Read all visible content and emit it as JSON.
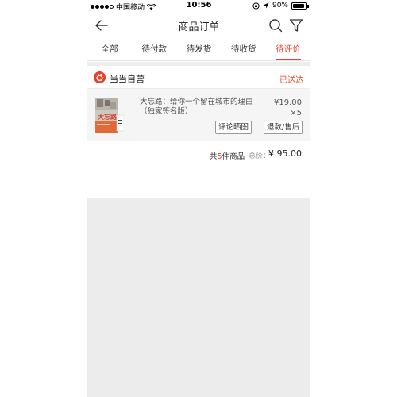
{
  "status_bar": {
    "carrier": "中国移动",
    "time": "10:56",
    "battery": "90%",
    "battery_level": 0.9
  },
  "nav": {
    "title": "商品订单",
    "back_icon": "back-arrow-icon",
    "search_icon": "search-icon",
    "filter_icon": "filter-icon"
  },
  "tabs": [
    {
      "label": "全部",
      "active": false
    },
    {
      "label": "待付款",
      "active": false
    },
    {
      "label": "待发货",
      "active": false
    },
    {
      "label": "待收货",
      "active": false
    },
    {
      "label": "待评价",
      "active": true
    }
  ],
  "order": {
    "shop_name": "当当自营",
    "status": "已送达",
    "product": {
      "title_line1": "大忘路：给你一个留在城市的理由",
      "title_line2": "（独家签名版）",
      "price": "¥19.00",
      "quantity": "×5",
      "cover_text": "大忘路"
    },
    "buttons": {
      "review": "评论晒图",
      "refund": "退款/售后"
    },
    "summary": {
      "prefix": "共",
      "count": "5",
      "suffix": "件商品",
      "total_label": "总价：",
      "total": "¥ 95.00"
    }
  },
  "colors": {
    "accent": "#e8412c",
    "background_gray": "#ececec"
  }
}
